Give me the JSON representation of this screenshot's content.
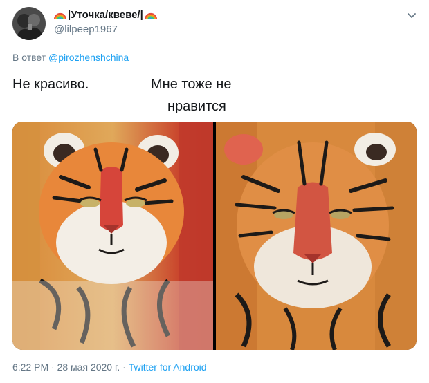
{
  "author": {
    "display_name": "|Уточка/квеве/|",
    "handle": "@lilpeep1967"
  },
  "reply": {
    "prefix": "В ответ",
    "to": "@pirozhenshchina"
  },
  "captions": {
    "left": "Не красиво.",
    "right_line1": "Мне тоже не",
    "right_line2": "нравится"
  },
  "meta": {
    "time": "6:22 PM",
    "separator1": " · ",
    "date": "28 мая 2020 г.",
    "separator2": " · ",
    "source": "Twitter for Android"
  },
  "icons": {
    "rainbow": "rainbow-emoji",
    "menu": "chevron-down-icon"
  },
  "colors": {
    "link": "#1da1f2",
    "muted": "#657786",
    "text": "#14171a"
  }
}
